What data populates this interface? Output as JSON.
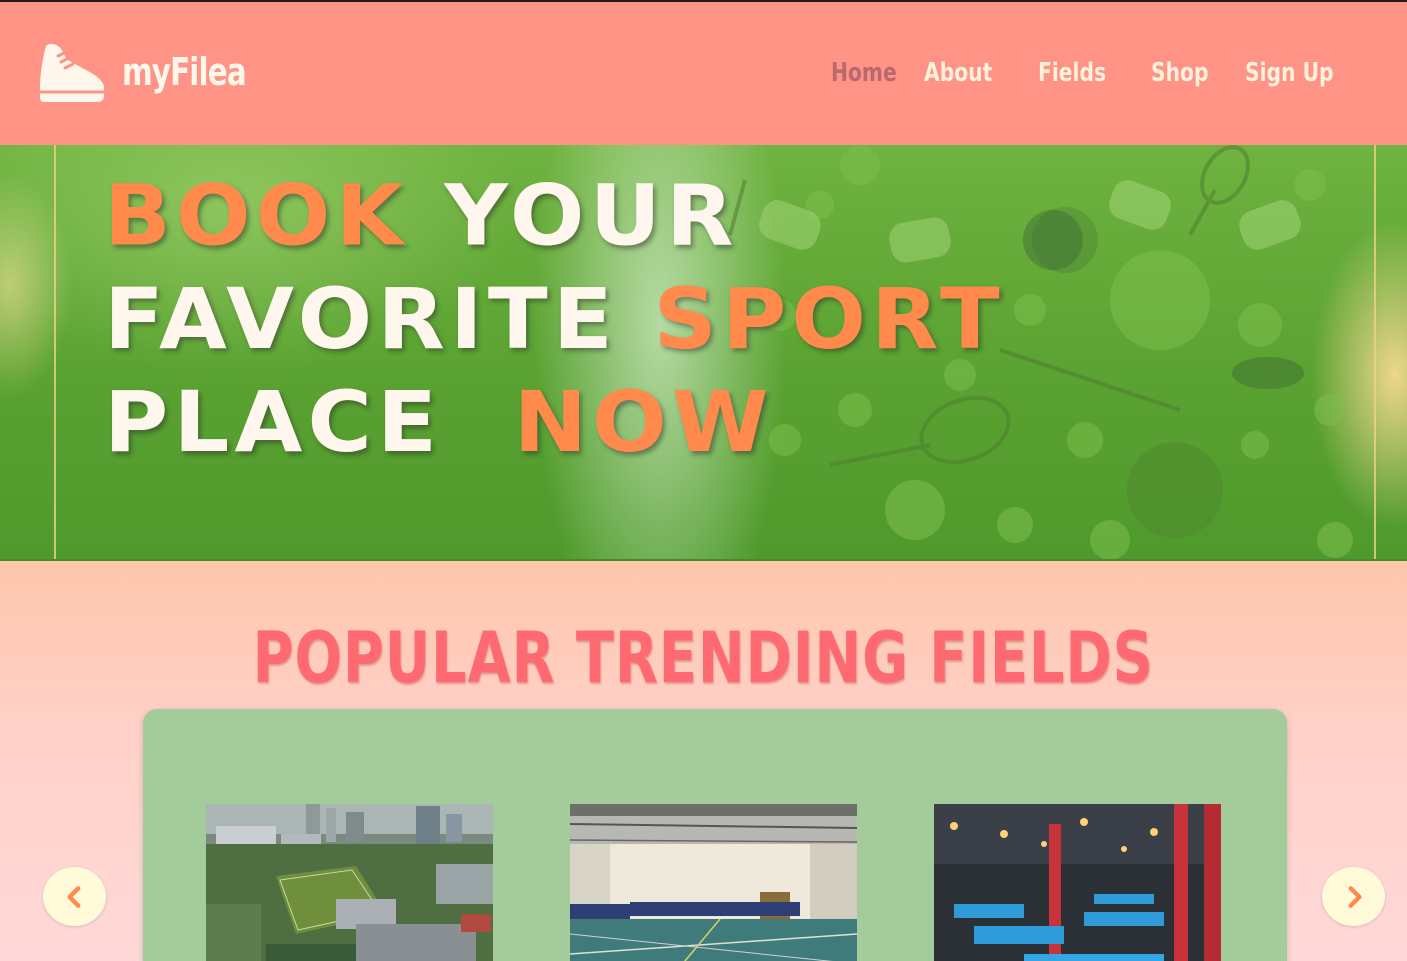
{
  "header": {
    "logo_text": "myFilea",
    "logo_icon": "sneaker-icon",
    "nav": [
      {
        "label": "Home",
        "active": true
      },
      {
        "label": "About",
        "active": false
      },
      {
        "label": "Fields",
        "active": false
      },
      {
        "label": "Shop",
        "active": false
      },
      {
        "label": "Sign Up",
        "active": false
      }
    ]
  },
  "hero": {
    "line1": {
      "part1": "BOOK",
      "part2": "YOUR"
    },
    "line2": {
      "part1": "FAVORITE",
      "part2": "SPORT"
    },
    "line3": {
      "part1": "PLACE",
      "part2": "NOW"
    }
  },
  "trending": {
    "title": "POPULAR TRENDING FIELDS",
    "prev_icon": "chevron-left-icon",
    "next_icon": "chevron-right-icon"
  },
  "colors": {
    "header_bg": "#ff9386",
    "nav_text": "#fff1dc",
    "nav_active": "#b76a6d",
    "hero_orange": "#ff8a4c",
    "section_title": "#ff6a72",
    "panel_bg": "#a4cc9a",
    "arrow_bg": "#fffbd9",
    "arrow_icon": "#ff8a4c"
  }
}
